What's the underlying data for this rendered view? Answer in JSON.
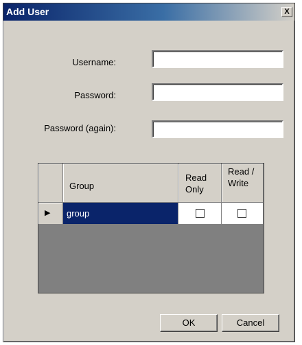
{
  "window": {
    "title": "Add User",
    "close_glyph": "X"
  },
  "form": {
    "username_label": "Username:",
    "password_label": "Password:",
    "password_again_label": "Password (again):",
    "username_value": "",
    "password_value": "",
    "password_again_value": ""
  },
  "grid": {
    "headers": {
      "group": "Group",
      "read_only": "Read Only",
      "read_write": "Read / Write"
    },
    "rows": [
      {
        "indicator": "▶",
        "group": "group",
        "read_only": false,
        "read_write": false
      }
    ]
  },
  "buttons": {
    "ok": "OK",
    "cancel": "Cancel"
  },
  "colors": {
    "title_active": "#0a246a",
    "selection": "#0a246a",
    "face": "#d4d0c8",
    "grid_bg": "#808080"
  }
}
